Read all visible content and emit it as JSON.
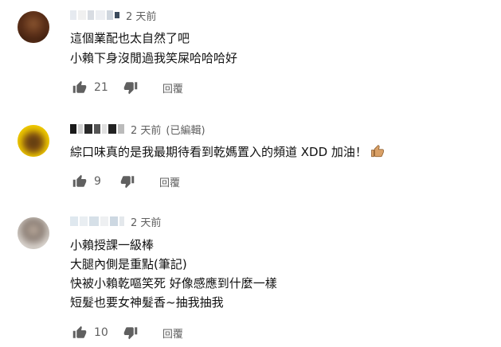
{
  "comments": [
    {
      "time": "2 天前",
      "edited": "",
      "lines": [
        "這個業配也太自然了吧",
        "小賴下身沒閒過我笑屎哈哈哈好"
      ],
      "likes": "21",
      "reply_label": "回覆"
    },
    {
      "time": "2 天前",
      "edited": "(已編輯)",
      "lines": [
        "綜口味真的是我最期待看到乾媽置入的頻道 XDD 加油！"
      ],
      "likes": "9",
      "reply_label": "回覆"
    },
    {
      "time": "2 天前",
      "edited": "",
      "lines": [
        "小賴授課一級棒",
        "大腿內側是重點(筆記)",
        "快被小賴乾嘔笑死 好像感應到什麼一樣",
        "短髮也要女神髮香~抽我抽我"
      ],
      "likes": "10",
      "reply_label": "回覆"
    }
  ],
  "icons": {
    "like": "thumbs-up-icon",
    "dislike": "thumbs-down-icon",
    "emoji": "thumbs-up-emoji"
  },
  "colors": {
    "text": "#111111",
    "meta": "#606060",
    "icon": "#606060"
  }
}
